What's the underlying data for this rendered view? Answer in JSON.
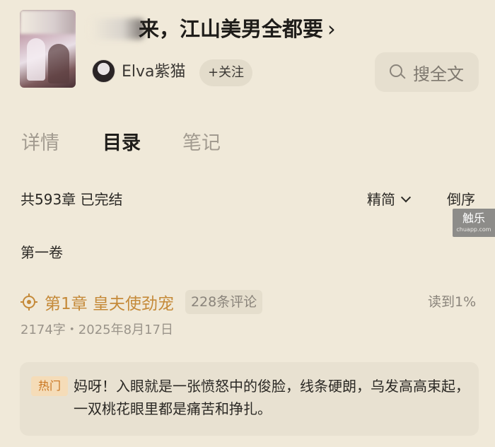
{
  "book": {
    "title": "归来，江山美男全都要",
    "title_visible": "归来，江山美男全都要",
    "title_chevron": "›",
    "author": "Elva紫猫",
    "follow_label": "+关注"
  },
  "search": {
    "label": "搜全文",
    "icon": "search-icon"
  },
  "tabs": [
    {
      "label": "详情",
      "active": false
    },
    {
      "label": "目录",
      "active": true
    },
    {
      "label": "笔记",
      "active": false
    }
  ],
  "toc": {
    "summary": "共593章 已完结",
    "sort_simple_label": "精简",
    "sort_reverse_label": "倒序",
    "volume": "第一卷"
  },
  "watermark": {
    "big": "触乐",
    "small": "chuapp.com"
  },
  "chapter": {
    "title": "第1章 皇夫使劲宠",
    "comments": "228条评论",
    "progress": "读到1%",
    "meta": "2174字・2025年8月17日",
    "icon": "target-icon"
  },
  "hot": {
    "badge": "热门",
    "text": "妈呀！入眼就是一张愤怒中的俊脸，线条硬朗，乌发高高束起，一双桃花眼里都是痛苦和挣扎。"
  },
  "colors": {
    "background": "#f0e9d9",
    "accent": "#c58a39",
    "hot_badge_bg": "#f5dcb8",
    "hot_badge_text": "#c9741e"
  }
}
